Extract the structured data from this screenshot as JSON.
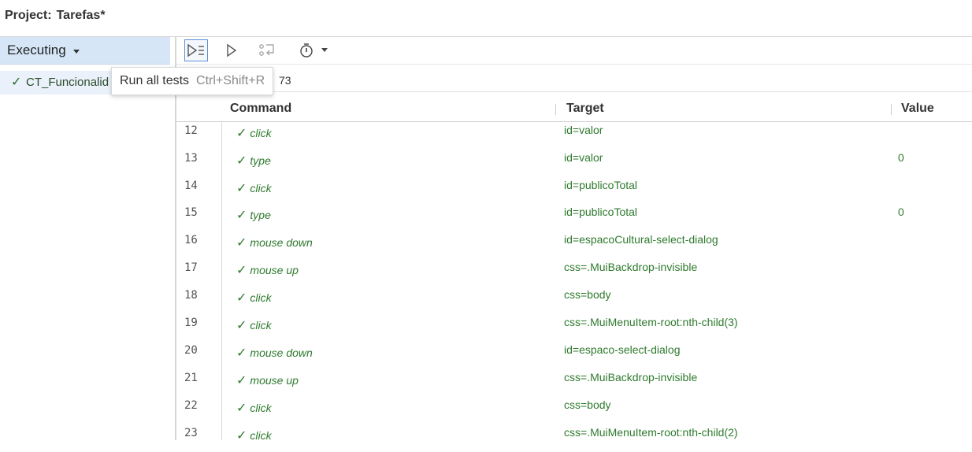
{
  "project": {
    "label": "Project:",
    "name": "Tarefas*"
  },
  "sidebar": {
    "header_label": "Executing",
    "test_item": {
      "check": "✓",
      "name": "CT_Funcionalid"
    }
  },
  "toolbar": {
    "buttons": [
      "run-all-tests",
      "run-current-test",
      "step-over",
      "test-speed"
    ]
  },
  "url_row": {
    "text": "73"
  },
  "tooltip": {
    "label": "Run all tests",
    "shortcut": "Ctrl+Shift+R"
  },
  "table": {
    "headers": {
      "command": "Command",
      "target": "Target",
      "value": "Value"
    },
    "rows": [
      {
        "n": "12",
        "check": "✓",
        "command": "click",
        "target": "id=valor",
        "value": ""
      },
      {
        "n": "13",
        "check": "✓",
        "command": "type",
        "target": "id=valor",
        "value": "0"
      },
      {
        "n": "14",
        "check": "✓",
        "command": "click",
        "target": "id=publicoTotal",
        "value": ""
      },
      {
        "n": "15",
        "check": "✓",
        "command": "type",
        "target": "id=publicoTotal",
        "value": "0"
      },
      {
        "n": "16",
        "check": "✓",
        "command": "mouse down",
        "target": "id=espacoCultural-select-dialog",
        "value": ""
      },
      {
        "n": "17",
        "check": "✓",
        "command": "mouse up",
        "target": "css=.MuiBackdrop-invisible",
        "value": ""
      },
      {
        "n": "18",
        "check": "✓",
        "command": "click",
        "target": "css=body",
        "value": ""
      },
      {
        "n": "19",
        "check": "✓",
        "command": "click",
        "target": "css=.MuiMenuItem-root:nth-child(3)",
        "value": ""
      },
      {
        "n": "20",
        "check": "✓",
        "command": "mouse down",
        "target": "id=espaco-select-dialog",
        "value": ""
      },
      {
        "n": "21",
        "check": "✓",
        "command": "mouse up",
        "target": "css=.MuiBackdrop-invisible",
        "value": ""
      },
      {
        "n": "22",
        "check": "✓",
        "command": "click",
        "target": "css=body",
        "value": ""
      },
      {
        "n": "23",
        "check": "✓",
        "command": "click",
        "target": "css=.MuiMenuItem-root:nth-child(2)",
        "value": ""
      }
    ]
  },
  "colors": {
    "pass_green": "#2e7a2e",
    "sidebar_header": "#d6e6f7",
    "accent_blue": "#5b8fd6"
  }
}
